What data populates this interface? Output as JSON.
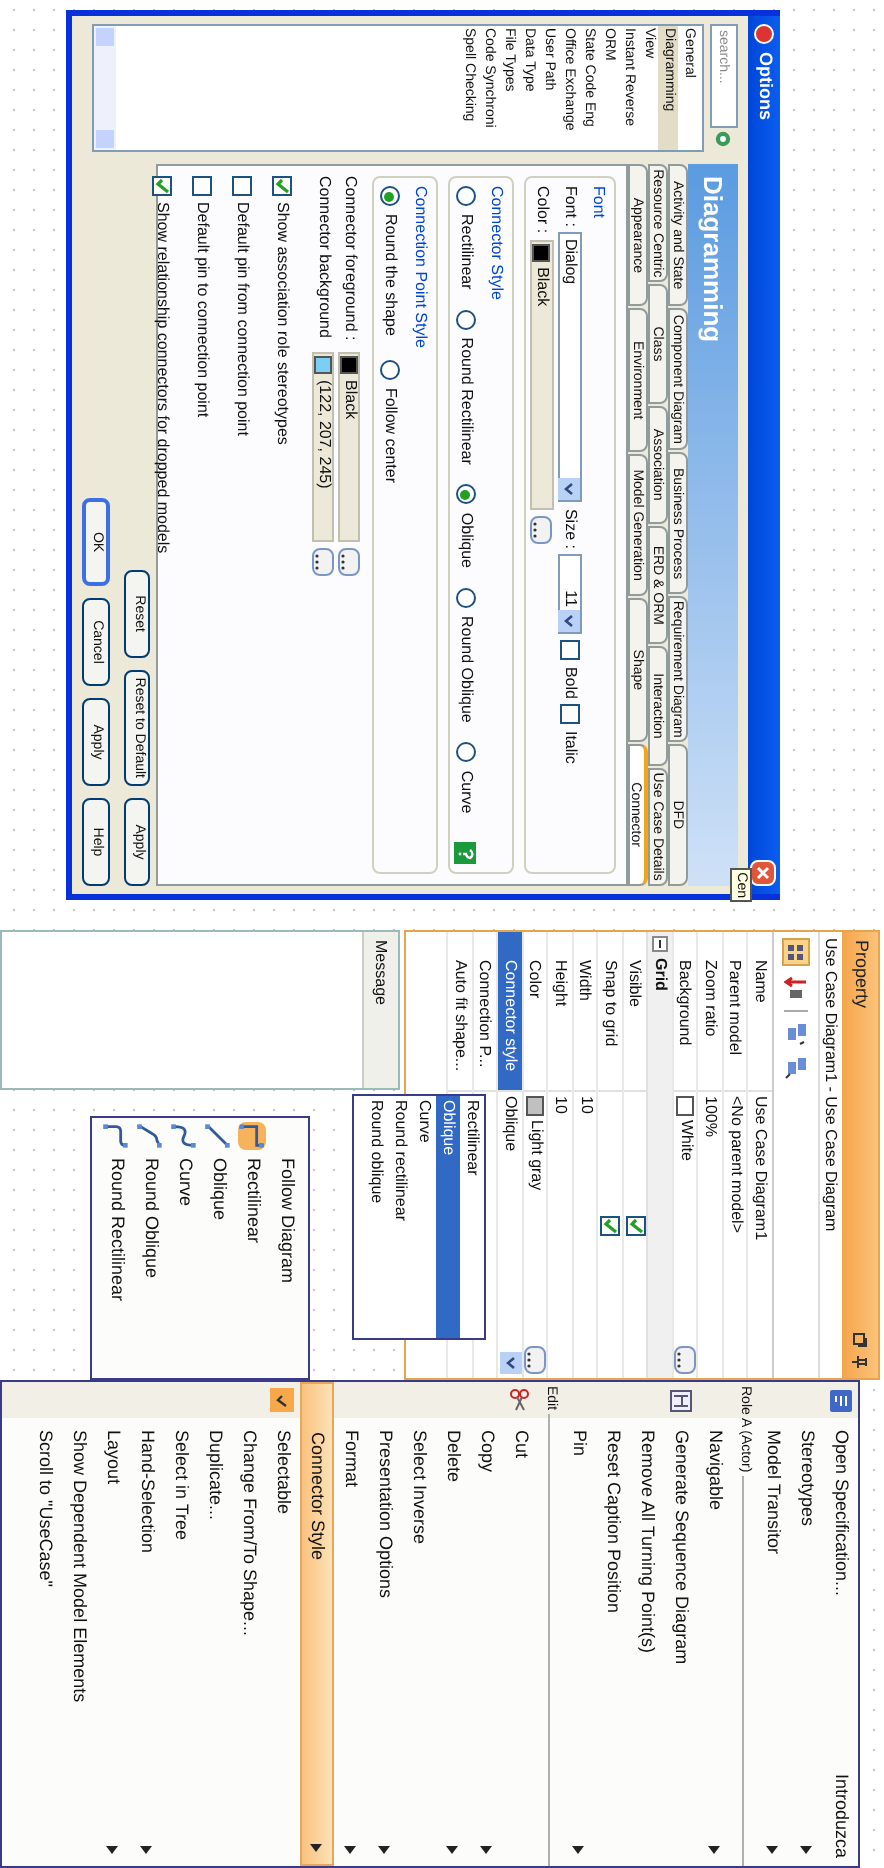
{
  "options_dialog": {
    "title": "Options",
    "search": {
      "placeholder": "search..."
    },
    "nav_items": [
      {
        "label": "General",
        "selected": false
      },
      {
        "label": "Diagramming",
        "selected": true
      },
      {
        "label": "View",
        "selected": false
      },
      {
        "label": "Instant Reverse",
        "selected": false
      },
      {
        "label": "ORM",
        "selected": false
      },
      {
        "label": "State Code Eng",
        "selected": false
      },
      {
        "label": "Office Exchange",
        "selected": false
      },
      {
        "label": "User Path",
        "selected": false
      },
      {
        "label": "Data Type",
        "selected": false
      },
      {
        "label": "File Types",
        "selected": false
      },
      {
        "label": "Code Synchroni",
        "selected": false
      },
      {
        "label": "Spell Checking",
        "selected": false
      }
    ],
    "header": "Diagramming",
    "tab_rows": [
      [
        {
          "label": "Activity and State",
          "selected": false
        },
        {
          "label": "Component Diagram",
          "selected": false
        },
        {
          "label": "Business Process",
          "selected": false
        },
        {
          "label": "Requirement Diagram",
          "selected": false
        },
        {
          "label": "DFD",
          "selected": false
        }
      ],
      [
        {
          "label": "Resource Centric",
          "selected": false
        },
        {
          "label": "Class",
          "selected": false
        },
        {
          "label": "Association",
          "selected": false
        },
        {
          "label": "ERD & ORM",
          "selected": false
        },
        {
          "label": "Interaction",
          "selected": false
        },
        {
          "label": "Use Case Details",
          "selected": false
        }
      ],
      [
        {
          "label": "Appearance",
          "selected": false
        },
        {
          "label": "Environment",
          "selected": false
        },
        {
          "label": "Model Generation",
          "selected": false
        },
        {
          "label": "Shape",
          "selected": false
        },
        {
          "label": "Connector",
          "selected": true
        }
      ]
    ],
    "font_group": {
      "legend": "Font",
      "font_label": "Font :",
      "font_value": "Dialog",
      "size_label": "Size :",
      "size_value": "11",
      "bold": {
        "label": "Bold",
        "checked": false
      },
      "italic": {
        "label": "Italic",
        "checked": false
      },
      "color_label": "Color :",
      "color_value": "Black",
      "color": "#000000"
    },
    "connector_style": {
      "legend": "Connector Style",
      "options": [
        {
          "label": "Rectilinear",
          "selected": false
        },
        {
          "label": "Round Rectilinear",
          "selected": false
        },
        {
          "label": "Oblique",
          "selected": true
        },
        {
          "label": "Round Oblique",
          "selected": false
        },
        {
          "label": "Curve",
          "selected": false
        }
      ]
    },
    "connection_point_style": {
      "legend": "Connection Point Style",
      "options": [
        {
          "label": "Round the shape",
          "selected": true
        },
        {
          "label": "Follow center",
          "selected": false
        }
      ]
    },
    "colors": [
      {
        "label": "Connector foreground :",
        "value": "Black",
        "color": "#000000"
      },
      {
        "label": "Connector background",
        "value": "(122, 207, 245)",
        "color": "#7acff5"
      }
    ],
    "checkboxes": [
      {
        "label": "Show association role stereotypes",
        "checked": true
      },
      {
        "label": "Default pin from connection point",
        "checked": false
      },
      {
        "label": "Default pin to connection point",
        "checked": false
      },
      {
        "label": "Show relationship connectors for dropped models",
        "checked": true
      }
    ],
    "panel_buttons": [
      "Reset",
      "Reset to Default",
      "Apply"
    ],
    "dialog_buttons": [
      "OK",
      "Cancel",
      "Apply",
      "Help"
    ],
    "tooltip": "Cen"
  },
  "property_panel": {
    "title": "Property",
    "subtitle": "Use Case Diagram1 - Use Case Diagram",
    "rows": [
      {
        "kind": "text",
        "name": "Name",
        "value": "Use Case Diagram1"
      },
      {
        "kind": "text",
        "name": "Parent model",
        "value": "<No parent model>"
      },
      {
        "kind": "text",
        "name": "Zoom ratio",
        "value": "100%"
      },
      {
        "kind": "swatch",
        "name": "Background",
        "value": "White",
        "color": "#ffffff"
      },
      {
        "kind": "section",
        "name": "Grid",
        "expanded": true
      },
      {
        "kind": "check",
        "name": "Visible",
        "checked": true
      },
      {
        "kind": "check",
        "name": "Snap to grid",
        "checked": true
      },
      {
        "kind": "text",
        "name": "Width",
        "value": "10"
      },
      {
        "kind": "text",
        "name": "Height",
        "value": "10"
      },
      {
        "kind": "swatch",
        "name": "Color",
        "value": "Light gray",
        "color": "#c0c0c0"
      },
      {
        "kind": "select",
        "name": "Connector style",
        "value": "Oblique",
        "selected": true
      },
      {
        "kind": "text",
        "name": "Connection P..."
      },
      {
        "kind": "text",
        "name": "Auto fit shape..."
      }
    ],
    "dropdown_options": [
      {
        "label": "Rectilinear",
        "selected": false
      },
      {
        "label": "Oblique",
        "selected": true
      },
      {
        "label": "Curve",
        "selected": false
      },
      {
        "label": "Round rectilinear",
        "selected": false
      },
      {
        "label": "Round oblique",
        "selected": false
      }
    ],
    "message_tab": "Message"
  },
  "connector_submenu": [
    {
      "label": "Follow Diagram",
      "selected": false
    },
    {
      "label": "Rectilinear",
      "selected": true
    },
    {
      "label": "Oblique",
      "selected": false
    },
    {
      "label": "Curve",
      "selected": false
    },
    {
      "label": "Round Oblique",
      "selected": false
    },
    {
      "label": "Round Rectilinear",
      "selected": false
    }
  ],
  "context_menu": [
    {
      "kind": "item",
      "label": "Open Specification...",
      "shortcut": "Introduzca",
      "submenu": false,
      "highlighted": false
    },
    {
      "kind": "item",
      "label": "Stereotypes",
      "submenu": true,
      "highlighted": false
    },
    {
      "kind": "item",
      "label": "Model Transitor",
      "submenu": true,
      "highlighted": false
    },
    {
      "kind": "heading",
      "label": "Role A (Actor)"
    },
    {
      "kind": "item",
      "label": "Navigable",
      "submenu": true,
      "highlighted": false
    },
    {
      "kind": "item",
      "label": "Generate Sequence Diagram",
      "submenu": false,
      "highlighted": false
    },
    {
      "kind": "item",
      "label": "Remove All Turning Point(s)",
      "submenu": false,
      "highlighted": false
    },
    {
      "kind": "item",
      "label": "Reset Caption Position",
      "submenu": false,
      "highlighted": false
    },
    {
      "kind": "item",
      "label": "Pin",
      "submenu": true,
      "highlighted": false
    },
    {
      "kind": "heading",
      "label": "Edit"
    },
    {
      "kind": "item",
      "label": "Cut",
      "submenu": false,
      "highlighted": false
    },
    {
      "kind": "item",
      "label": "Copy",
      "submenu": true,
      "highlighted": false
    },
    {
      "kind": "item",
      "label": "Delete",
      "submenu": true,
      "highlighted": false
    },
    {
      "kind": "item",
      "label": "Select Inverse",
      "submenu": false,
      "highlighted": false
    },
    {
      "kind": "item",
      "label": "Presentation Options",
      "submenu": true,
      "highlighted": false
    },
    {
      "kind": "item",
      "label": "Format",
      "submenu": true,
      "highlighted": false
    },
    {
      "kind": "item",
      "label": "Connector Style",
      "submenu": true,
      "highlighted": true
    },
    {
      "kind": "item",
      "label": "Selectable",
      "submenu": false,
      "highlighted": false
    },
    {
      "kind": "item",
      "label": "Change From/To Shape...",
      "submenu": false,
      "highlighted": false
    },
    {
      "kind": "item",
      "label": "Duplicate...",
      "submenu": false,
      "highlighted": false
    },
    {
      "kind": "item",
      "label": "Select in Tree",
      "submenu": false,
      "highlighted": false
    },
    {
      "kind": "item",
      "label": "Hand-Selection",
      "submenu": true,
      "highlighted": false
    },
    {
      "kind": "item",
      "label": "Layout",
      "submenu": true,
      "highlighted": false
    },
    {
      "kind": "item",
      "label": "Show Dependent Model Elements",
      "submenu": false,
      "highlighted": false
    },
    {
      "kind": "item",
      "label": "Scroll to \"UseCase\"",
      "submenu": false,
      "highlighted": false
    }
  ]
}
